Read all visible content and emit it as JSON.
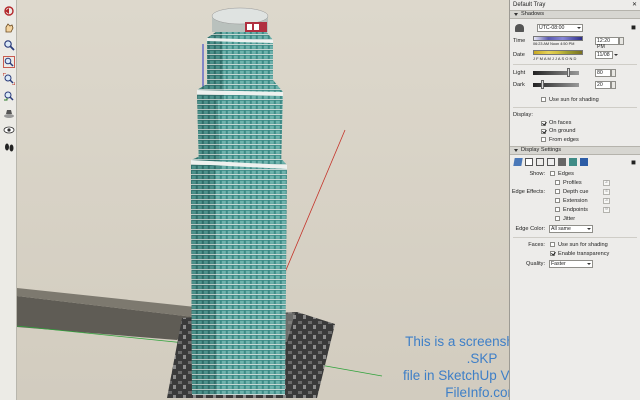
{
  "toolbar": {
    "tools": [
      "orbit-icon",
      "pan-icon",
      "zoom-icon",
      "zoom-window-icon",
      "zoom-extents-icon",
      "previous-view-icon",
      "position-camera-icon",
      "look-around-icon",
      "walk-icon"
    ]
  },
  "viewport": {
    "watermark_lines": [
      "This is a screenshot of an .SKP",
      "file in SketchUp Viewer for",
      "FileInfo.com"
    ]
  },
  "tray": {
    "title": "Default Tray",
    "shadows": {
      "header": "Shadows",
      "timezone": "UTC-08:00",
      "time_label": "Time",
      "time_marks": "06:23 AM   Noon   4:50 PM",
      "time_value": "12:20 PM",
      "date_label": "Date",
      "month_letters": "J F M A M J J A S O N D",
      "date_value": "11/08",
      "light_label": "Light",
      "light_value": "80",
      "dark_label": "Dark",
      "dark_value": "20",
      "use_sun": "Use sun for shading",
      "display_label": "Display:",
      "on_faces": "On faces",
      "on_ground": "On ground",
      "from_edges": "From edges"
    },
    "display_settings": {
      "header": "Display Settings",
      "show_label": "Show:",
      "edges": "Edges",
      "edge_effects_label": "Edge Effects:",
      "profiles": "Profiles",
      "profiles_val": "2",
      "depth_cue": "Depth cue",
      "depth_cue_val": "4",
      "extension": "Extension",
      "extension_val": "3",
      "endpoints": "Endpoints",
      "endpoints_val": "9",
      "jitter": "Jitter",
      "edge_color_label": "Edge Color:",
      "edge_color_value": "All same",
      "faces_label": "Faces:",
      "faces_use_sun": "Use sun for shading",
      "enable_transparency": "Enable transparency",
      "quality_label": "Quality:",
      "quality_value": "Faster"
    }
  }
}
